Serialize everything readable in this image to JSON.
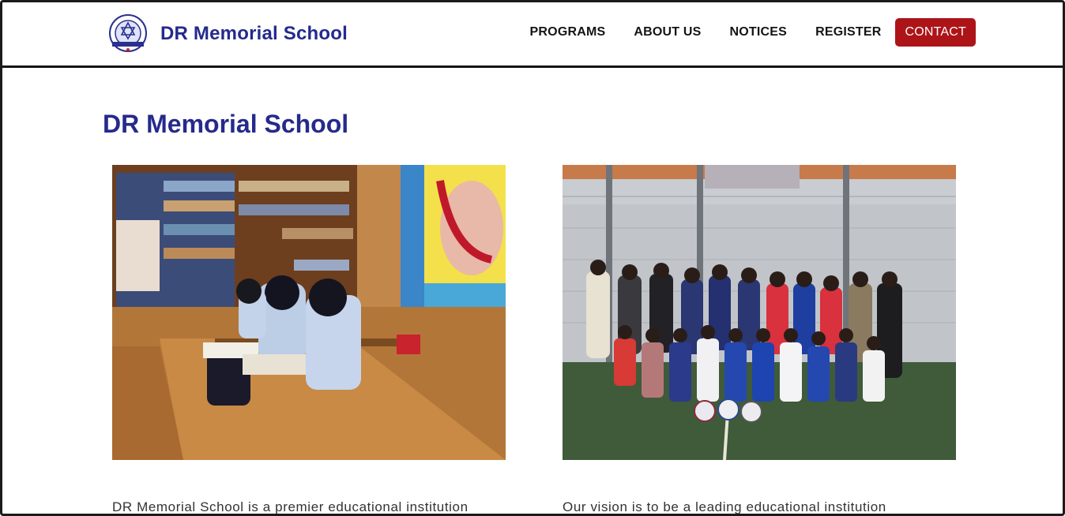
{
  "header": {
    "brand": "DR Memorial School",
    "nav": [
      "PROGRAMS",
      "ABOUT US",
      "NOTICES",
      "REGISTER"
    ],
    "contact_label": "CONTACT",
    "colors": {
      "brand": "#252a8c",
      "contact_bg": "#ad1418"
    }
  },
  "main": {
    "title": "DR Memorial School",
    "left_caption": "DR Memorial School is a premier educational institution",
    "right_caption": "Our vision is to be a leading educational institution"
  }
}
